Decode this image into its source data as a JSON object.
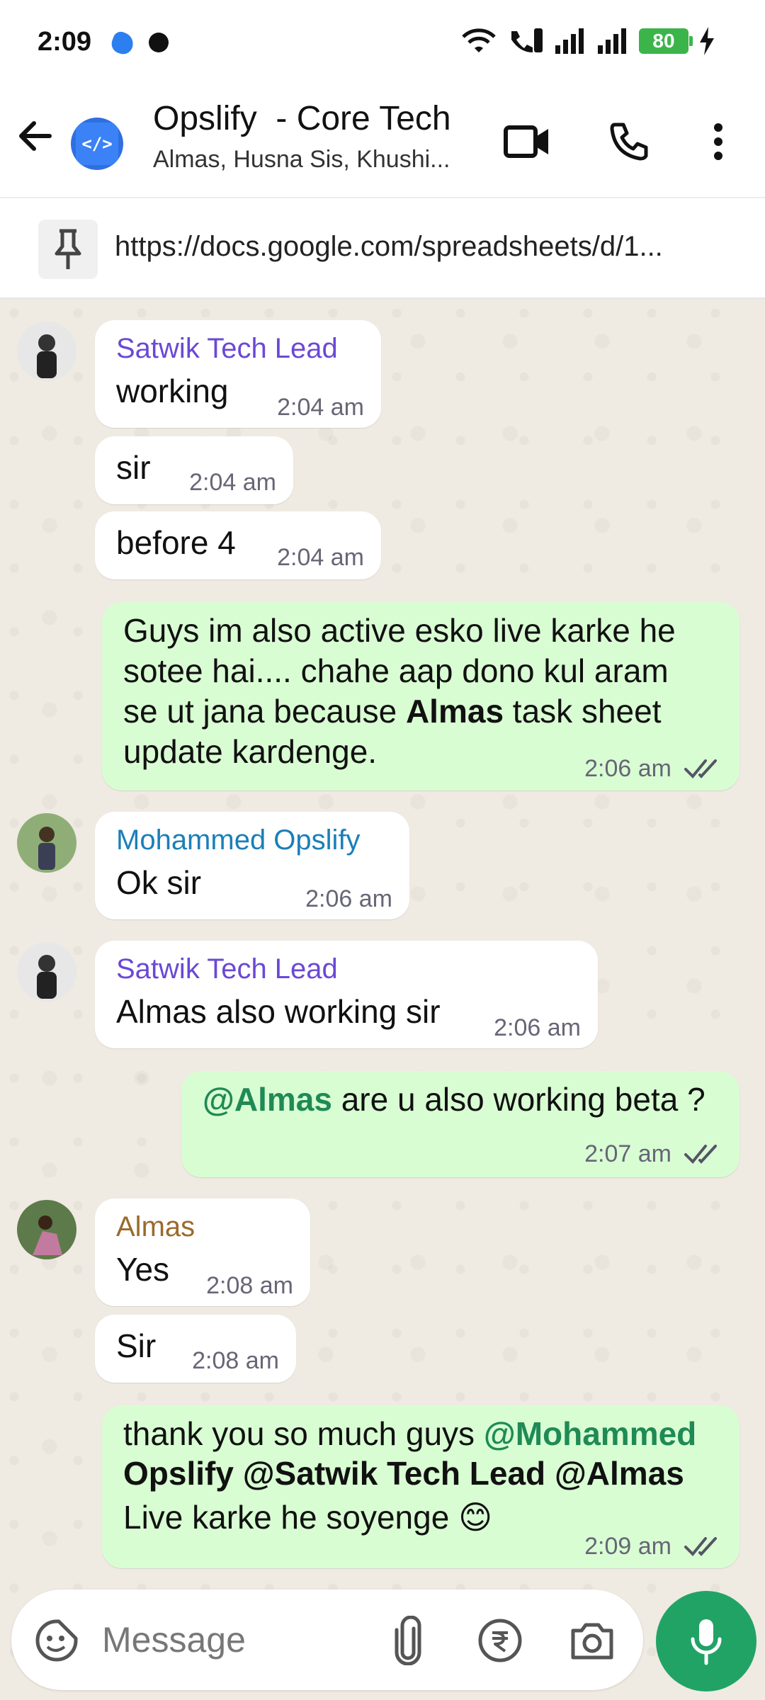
{
  "status_bar": {
    "time": "2:09",
    "battery": "80"
  },
  "header": {
    "title": "Opslify  - Core Tech",
    "subtitle": "Almas, Husna Sis, Khushi...",
    "avatar_label": "</>"
  },
  "pinned": {
    "url": "https://docs.google.com/spreadsheets/d/1..."
  },
  "colors": {
    "satwik": "#6b48d6",
    "mohammed": "#1b7fb8",
    "almas": "#9b6a2a",
    "mention": "#1f8a55",
    "outgoing_bubble": "#d9fdd3",
    "mic": "#21a366"
  },
  "messages": [
    {
      "sender": "Satwik Tech Lead",
      "text": "working",
      "time": "2:04 am"
    },
    {
      "text": "sir",
      "time": "2:04 am"
    },
    {
      "text": "before 4",
      "time": "2:04 am"
    },
    {
      "outgoing": true,
      "lines": [
        "Guys im also active esko live karke he",
        "sotee hai.... chahe aap dono kul aram",
        "se ut jana because ",
        "Almas",
        " task sheet",
        "update kardenge."
      ],
      "time": "2:06 am"
    },
    {
      "sender": "Mohammed Opslify",
      "text": "Ok sir",
      "time": "2:06 am"
    },
    {
      "sender": "Satwik Tech Lead",
      "text": "Almas also working sir",
      "time": "2:06 am"
    },
    {
      "outgoing": true,
      "mention": "@Almas",
      "text": " are u also working beta ?",
      "time": "2:07 am"
    },
    {
      "sender": "Almas",
      "text": "Yes",
      "time": "2:08 am"
    },
    {
      "text": "Sir",
      "time": "2:08 am"
    },
    {
      "outgoing": true,
      "line1_text": "thank you so much guys ",
      "line1_mention": "@Mohammed",
      "line2_mention": "Opslify @Satwik Tech Lead @Almas",
      "line3_text": "Live karke he soyenge ",
      "emoji": "😊",
      "time": "2:09 am"
    }
  ],
  "composer": {
    "placeholder": "Message"
  }
}
